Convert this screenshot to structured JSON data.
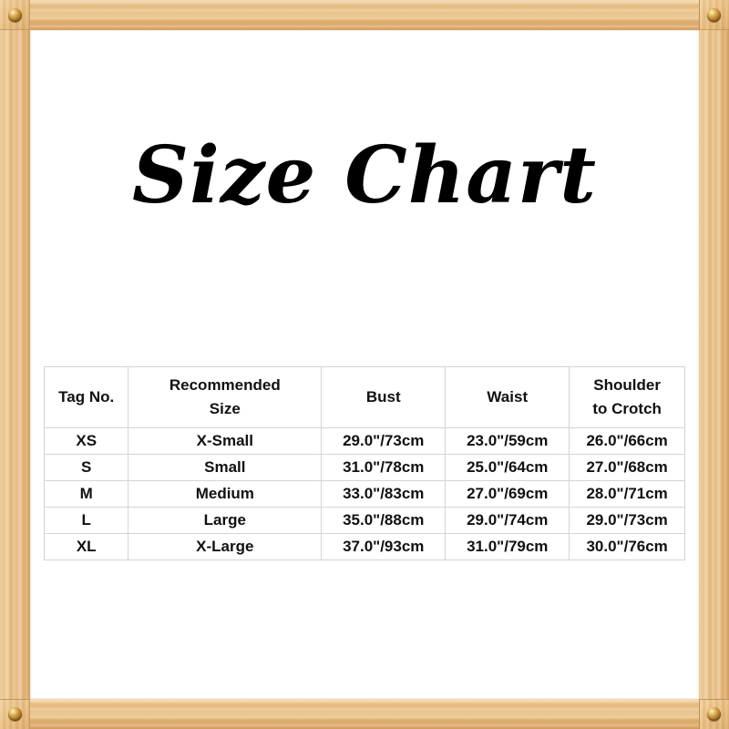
{
  "title": "Size Chart",
  "frame": {
    "material": "wood",
    "wood_color": "#e8bd80",
    "screw_color": "#a87426",
    "screws": [
      "screw-top-left",
      "screw-top-right",
      "screw-bottom-left",
      "screw-bottom-right"
    ]
  },
  "table": {
    "headers": [
      {
        "lines": [
          "Tag No."
        ]
      },
      {
        "lines": [
          "Recommended",
          "Size"
        ]
      },
      {
        "lines": [
          "Bust"
        ]
      },
      {
        "lines": [
          "Waist"
        ]
      },
      {
        "lines": [
          "Shoulder",
          "to Crotch"
        ]
      }
    ],
    "rows": [
      {
        "tag": "XS",
        "recommended_size": "X-Small",
        "bust": "29.0\"/73cm",
        "waist": "23.0\"/59cm",
        "shoulder_to_crotch": "26.0\"/66cm"
      },
      {
        "tag": "S",
        "recommended_size": "Small",
        "bust": "31.0\"/78cm",
        "waist": "25.0\"/64cm",
        "shoulder_to_crotch": "27.0\"/68cm"
      },
      {
        "tag": "M",
        "recommended_size": "Medium",
        "bust": "33.0\"/83cm",
        "waist": "27.0\"/69cm",
        "shoulder_to_crotch": "28.0\"/71cm"
      },
      {
        "tag": "L",
        "recommended_size": "Large",
        "bust": "35.0\"/88cm",
        "waist": "29.0\"/74cm",
        "shoulder_to_crotch": "29.0\"/73cm"
      },
      {
        "tag": "XL",
        "recommended_size": "X-Large",
        "bust": "37.0\"/93cm",
        "waist": "31.0\"/79cm",
        "shoulder_to_crotch": "30.0\"/76cm"
      }
    ]
  }
}
